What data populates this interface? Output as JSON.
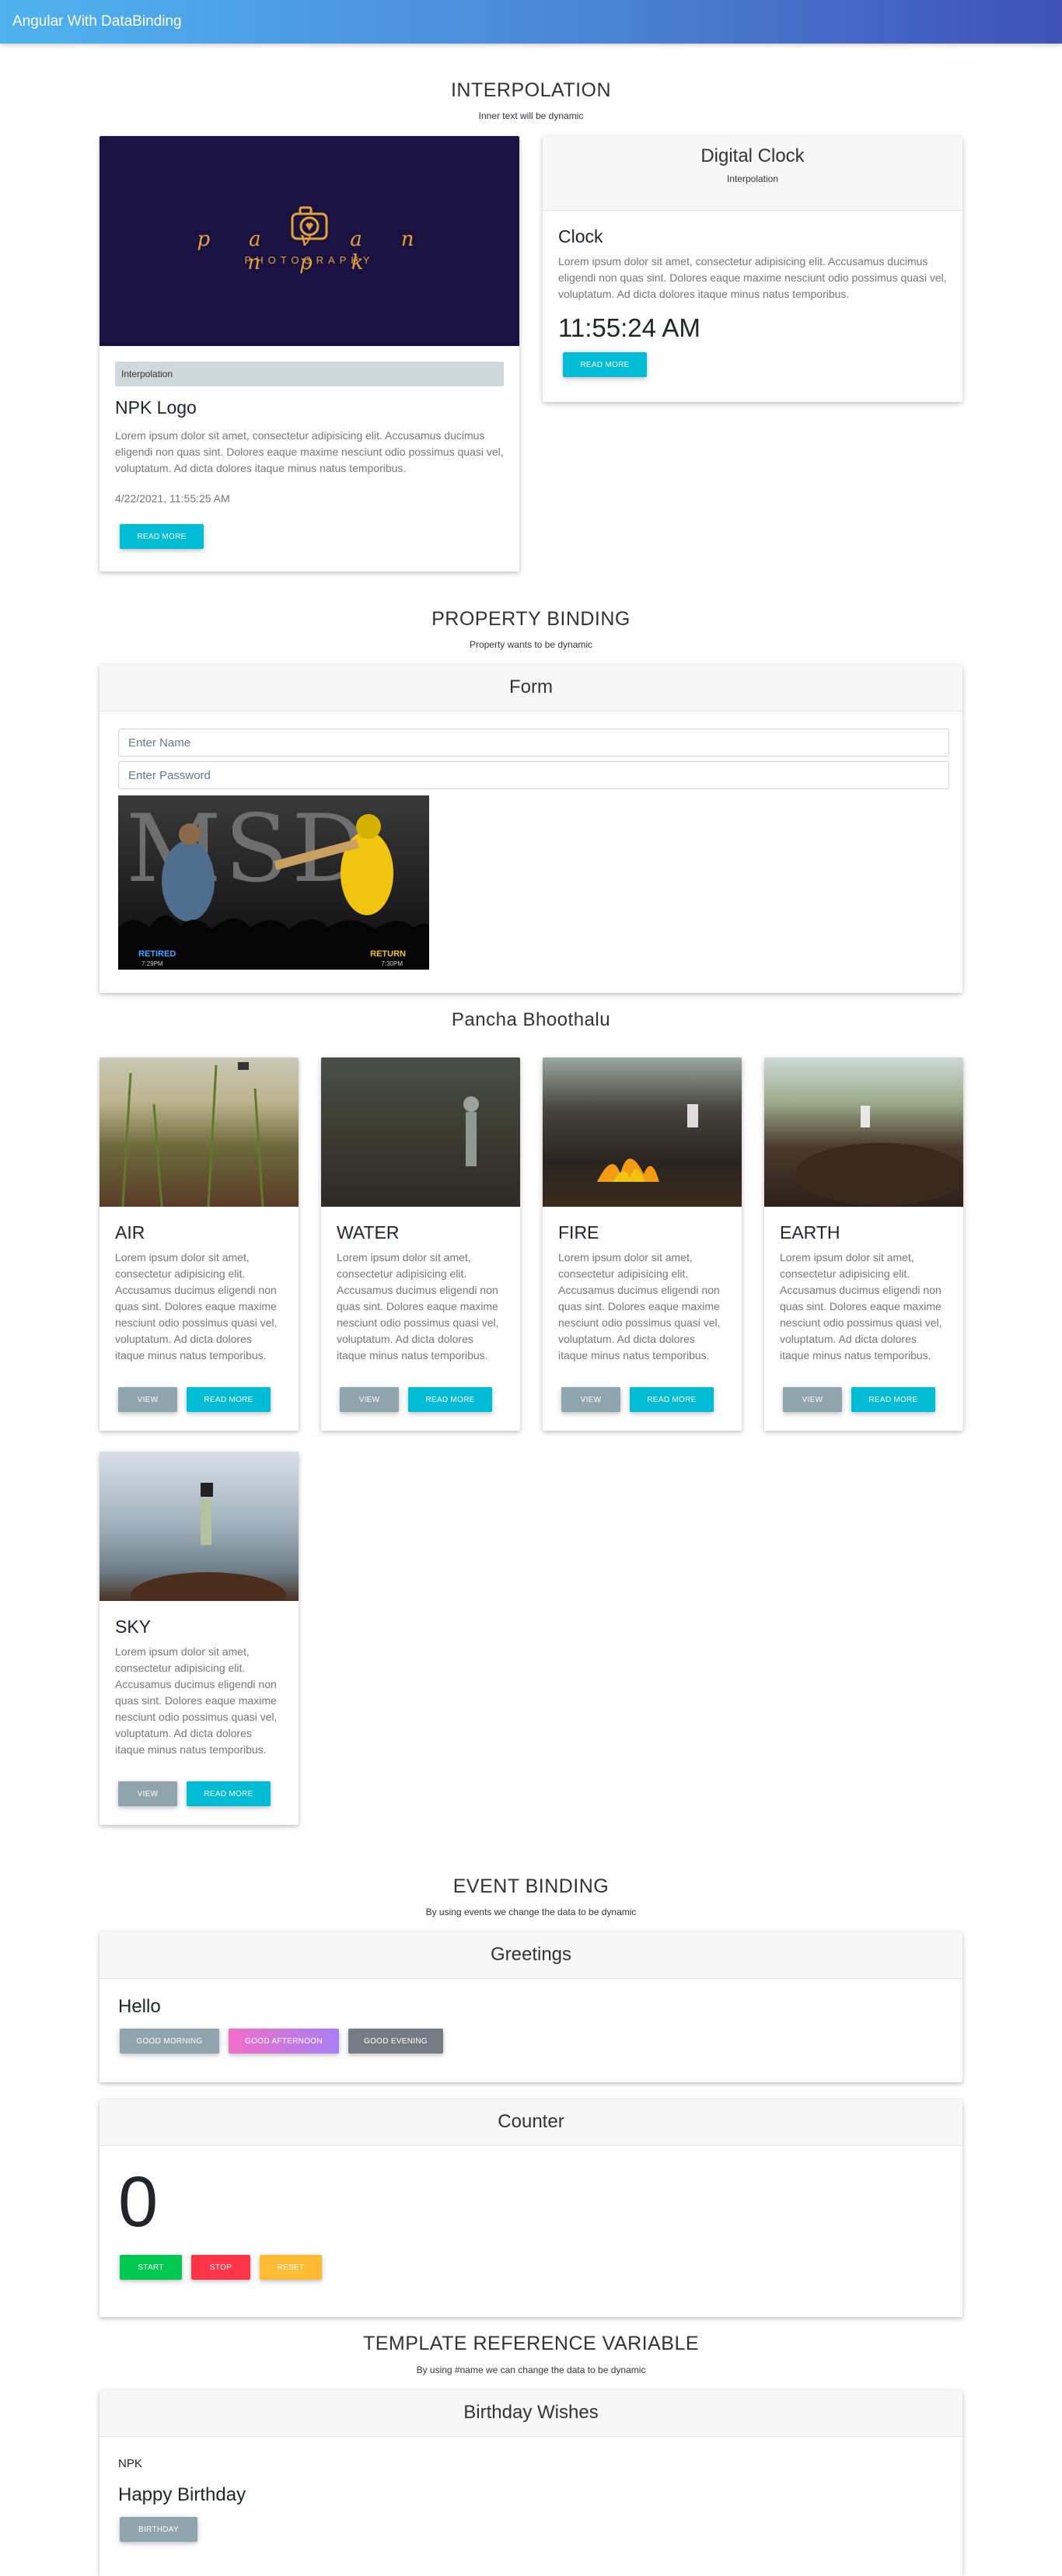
{
  "navbar": {
    "title": "Angular With DataBinding"
  },
  "interpolation": {
    "title": "INTERPOLATION",
    "subtitle": "Inner text will be dynamic",
    "logo_card": {
      "logo_script": "pavan npk",
      "logo_caption": "PHOTOGRAPHY",
      "badge": "Interpolation",
      "title": "NPK Logo",
      "text": "Lorem ipsum dolor sit amet, consectetur adipisicing elit. Accusamus ducimus eligendi non quas sint. Dolores eaque maxime nesciunt odio possimus quasi vel, voluptatum. Ad dicta dolores itaque minus natus temporibus.",
      "datetime": "4/22/2021, 11:55:25 AM",
      "button": "Read more"
    },
    "clock_card": {
      "header": "Digital Clock",
      "header_sub": "Interpolation",
      "title": "Clock",
      "text": "Lorem ipsum dolor sit amet, consectetur adipisicing elit. Accusamus ducimus eligendi non quas sint. Dolores eaque maxime nesciunt odio possimus quasi vel, voluptatum. Ad dicta dolores itaque minus natus temporibus.",
      "time": "11:55:24 AM",
      "button": "Read more"
    }
  },
  "property_binding": {
    "title": "PROPERTY BINDING",
    "subtitle": "Property wants to be dynamic",
    "form_header": "Form",
    "name_placeholder": "Enter Name",
    "password_placeholder": "Enter Password",
    "poster": {
      "big_text": "MSD",
      "left_label": "RETIRED",
      "left_time": "7:29PM",
      "right_label": "RETURN",
      "right_time": "7:30PM"
    }
  },
  "pancha": {
    "title": "Pancha Bhoothalu",
    "cards": [
      {
        "title": "AIR",
        "text": "Lorem ipsum dolor sit amet, consectetur adipisicing elit. Accusamus ducimus eligendi non quas sint. Dolores eaque maxime nesciunt odio possimus quasi vel, voluptatum. Ad dicta dolores itaque minus natus temporibus.",
        "view": "View",
        "more": "Read more"
      },
      {
        "title": "WATER",
        "text": "Lorem ipsum dolor sit amet, consectetur adipisicing elit. Accusamus ducimus eligendi non quas sint. Dolores eaque maxime nesciunt odio possimus quasi vel, voluptatum. Ad dicta dolores itaque minus natus temporibus.",
        "view": "View",
        "more": "Read more"
      },
      {
        "title": "FIRE",
        "text": "Lorem ipsum dolor sit amet, consectetur adipisicing elit. Accusamus ducimus eligendi non quas sint. Dolores eaque maxime nesciunt odio possimus quasi vel, voluptatum. Ad dicta dolores itaque minus natus temporibus.",
        "view": "View",
        "more": "Read more"
      },
      {
        "title": "EARTH",
        "text": "Lorem ipsum dolor sit amet, consectetur adipisicing elit. Accusamus ducimus eligendi non quas sint. Dolores eaque maxime nesciunt odio possimus quasi vel, voluptatum. Ad dicta dolores itaque minus natus temporibus.",
        "view": "View",
        "more": "Read more"
      },
      {
        "title": "SKY",
        "text": "Lorem ipsum dolor sit amet, consectetur adipisicing elit. Accusamus ducimus eligendi non quas sint. Dolores eaque maxime nesciunt odio possimus quasi vel, voluptatum. Ad dicta dolores itaque minus natus temporibus.",
        "view": "View",
        "more": "Read more"
      }
    ]
  },
  "event_binding": {
    "title": "EVENT BINDING",
    "subtitle": "By using events we change the data to be dynamic",
    "greetings": {
      "header": "Greetings",
      "message": "Hello",
      "buttons": [
        "Good Morning",
        "Good Afternoon",
        "Good Evening"
      ]
    },
    "counter": {
      "header": "Counter",
      "value": "0",
      "buttons": [
        "Start",
        "Stop",
        "Reset"
      ]
    }
  },
  "template_ref": {
    "title": "TEMPLATE REFERENCE VARIABLE",
    "subtitle": "By using #name we can change the data to be dynamic",
    "card": {
      "header": "Birthday Wishes",
      "name": "NPK",
      "message": "Happy Birthday",
      "button": "Birthday"
    }
  },
  "colors": {
    "info": "#00bcd4",
    "grey": "#90a4ae",
    "success": "#00c851",
    "danger": "#ff3547",
    "warning": "#ffbb33",
    "evening": "#757b85"
  }
}
